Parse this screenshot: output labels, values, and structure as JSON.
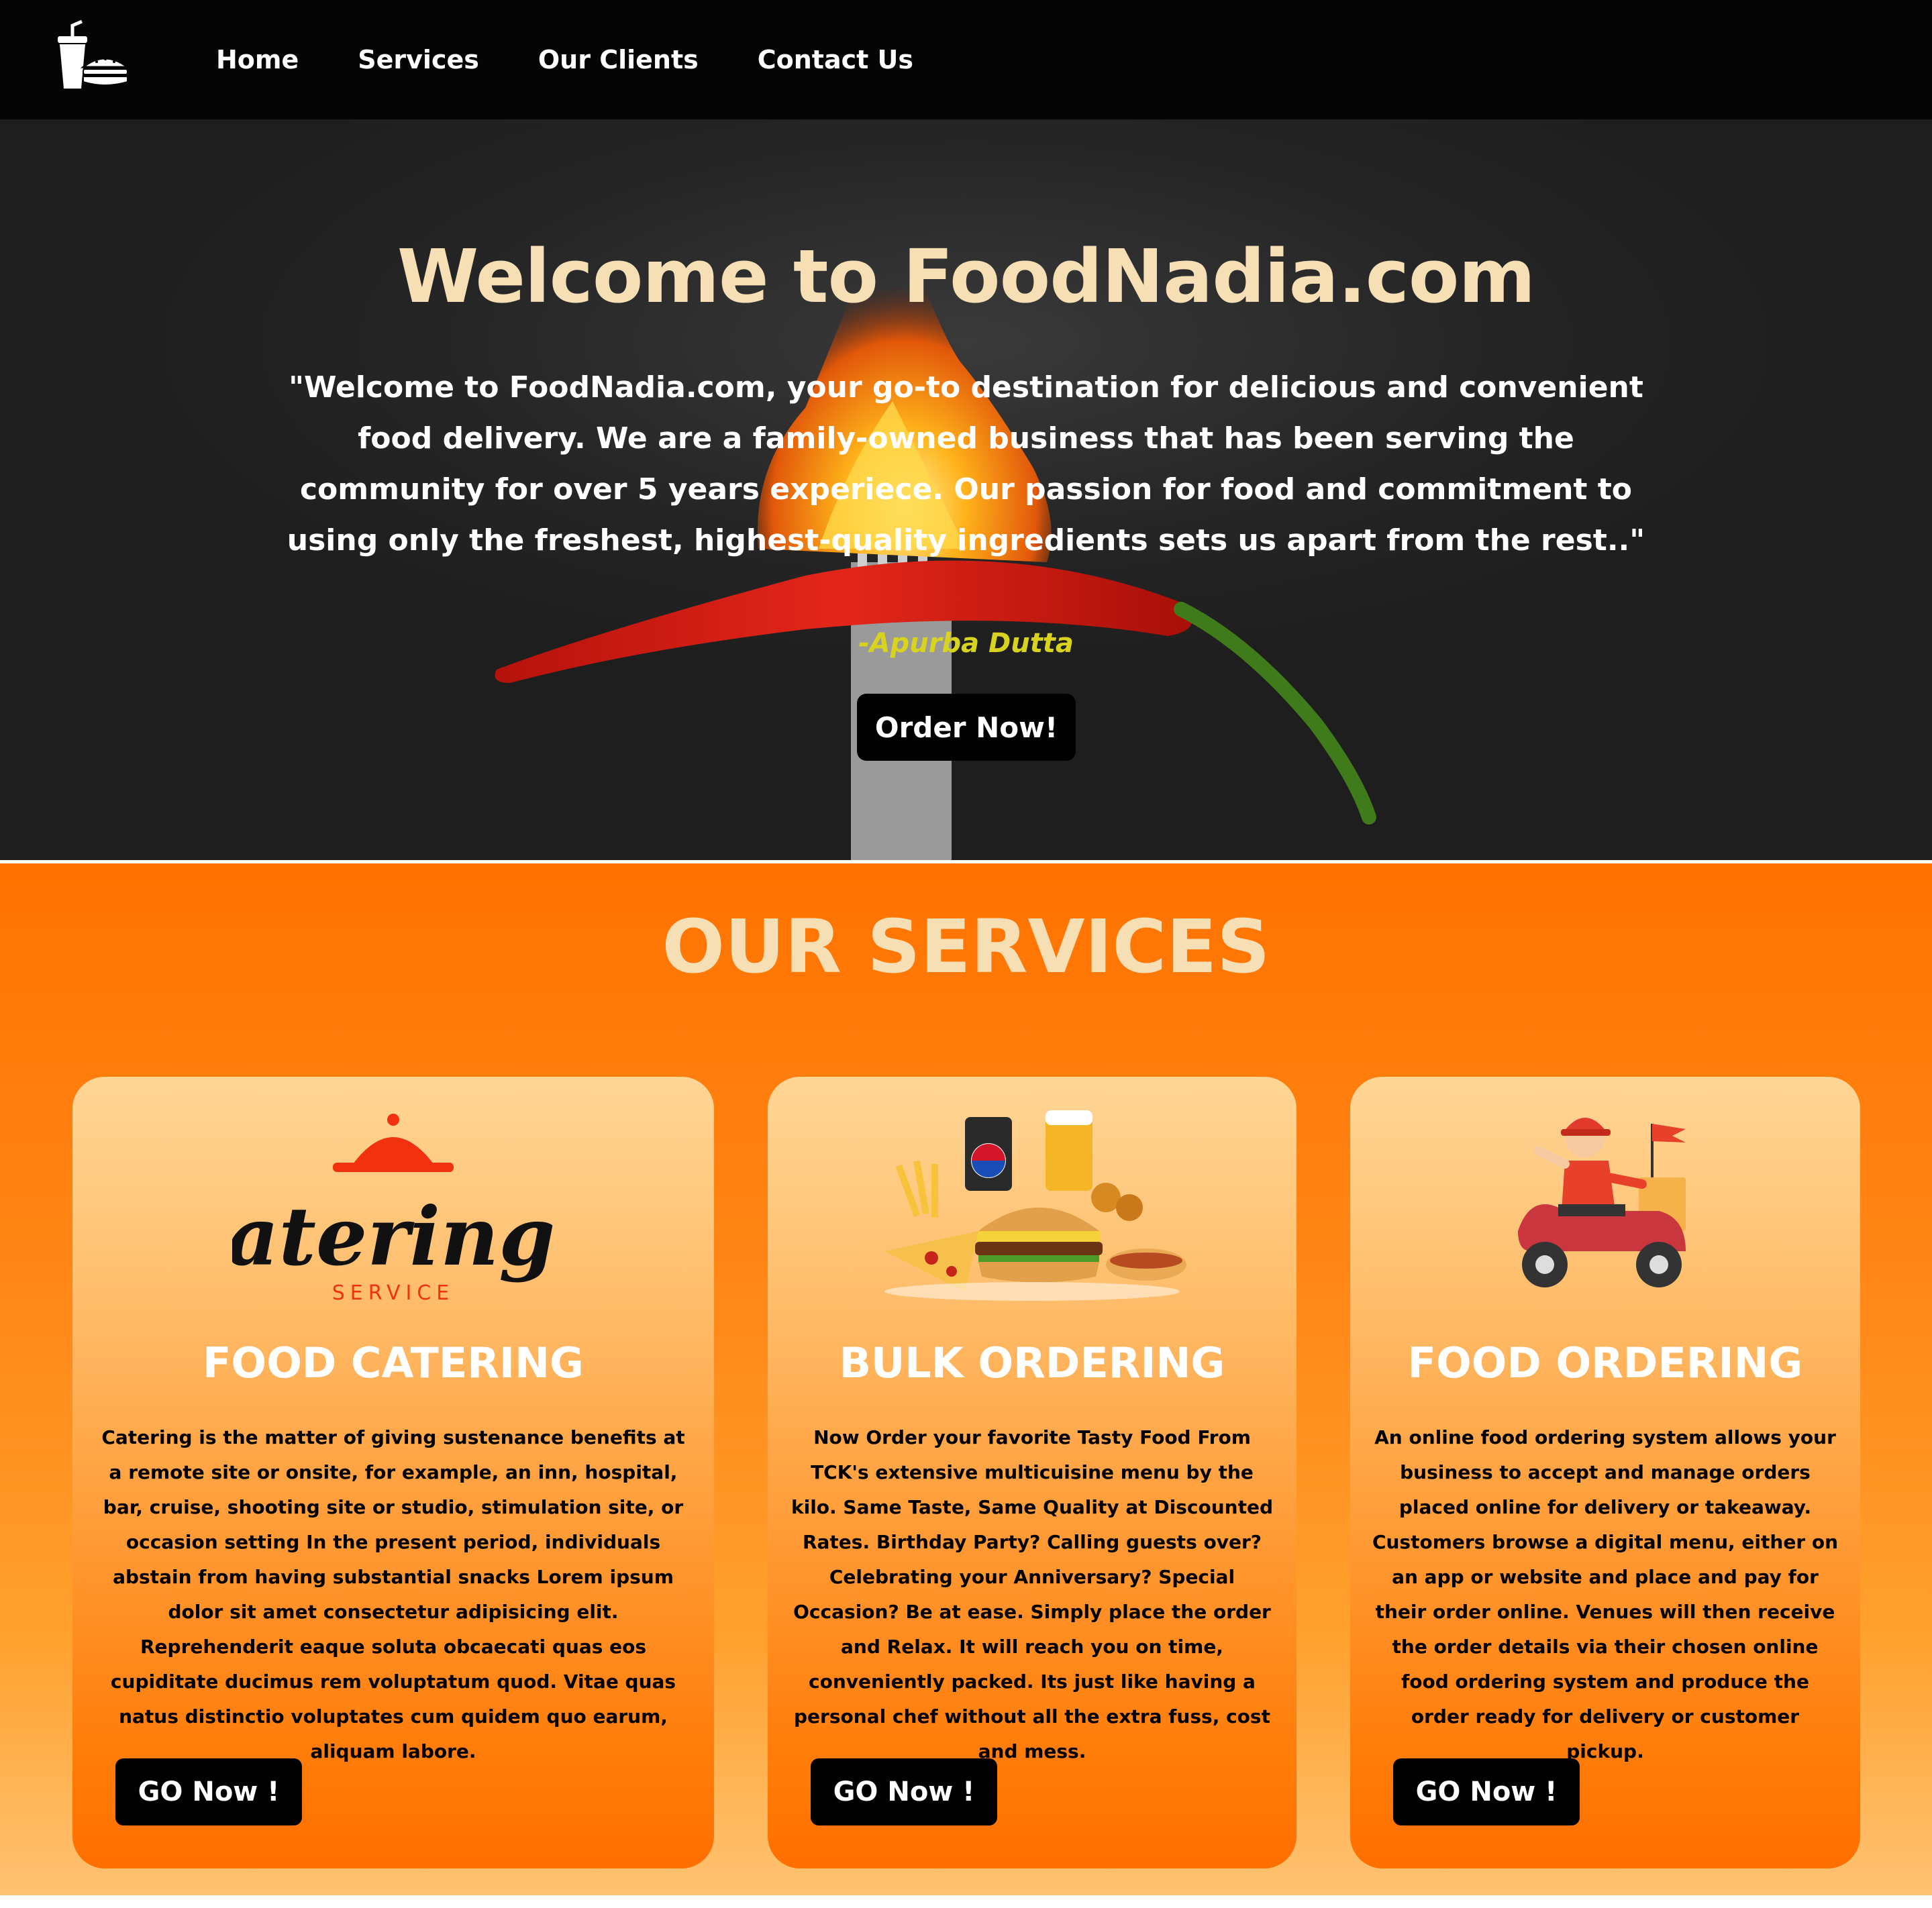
{
  "nav": {
    "links": [
      "Home",
      "Services",
      "Our Clients",
      "Contact Us"
    ]
  },
  "hero": {
    "title": "Welcome to FoodNadia.com",
    "quote": "\"Welcome to FoodNadia.com, your go-to destination for delicious and convenient food delivery. We are a family-owned business that has been serving the community for over 5 years experiece. Our passion for food and commitment to using only the freshest, highest-quality ingredients sets us apart from the rest..\"",
    "author": "-Apurba Dutta",
    "cta_label": "Order Now!"
  },
  "services": {
    "title": "OUR SERVICES",
    "cards": [
      {
        "title": "FOOD CATERING",
        "logo_text": "CateringG",
        "logo_subtext": "SERVICE",
        "text": "Catering is the matter of giving sustenance benefits at a remote site or onsite, for example, an inn, hospital, bar, cruise, shooting site or studio, stimulation site, or occasion setting In the present period, individuals abstain from having substantial snacks Lorem ipsum dolor sit amet consectetur adipisicing elit. Reprehenderit eaque soluta obcaecati quas eos cupiditate ducimus rem voluptatum quod. Vitae quas natus distinctio voluptates cum quidem quo earum, aliquam labore.",
        "button": "GO Now !"
      },
      {
        "title": "BULK ORDERING",
        "text": "Now Order your favorite Tasty Food From TCK's extensive multicuisine menu by the kilo. Same Taste, Same Quality at Discounted Rates. Birthday Party? Calling guests over? Celebrating your Anniversary? Special Occasion? Be at ease. Simply place the order and Relax. It will reach you on time, conveniently packed. Its just like having a personal chef without all the extra fuss, cost and mess.",
        "button": "GO Now !"
      },
      {
        "title": "FOOD ORDERING",
        "text": "An online food ordering system allows your business to accept and manage orders placed online for delivery or takeaway. Customers browse a digital menu, either on an app or website and place and pay for their order online. Venues will then receive the order details via their chosen online food ordering system and produce the order ready for delivery or customer pickup.",
        "button": "GO Now !"
      }
    ]
  },
  "colors": {
    "nav_bg": "#050505",
    "hero_title": "#f6dfb5",
    "author": "#d7d31f",
    "services_bg": "#ff7200",
    "button_bg": "#000000"
  },
  "icons": [
    "drink-burger-logo-icon",
    "catering-cloche-icon",
    "fast-food-combo-icon",
    "delivery-scooter-icon"
  ]
}
